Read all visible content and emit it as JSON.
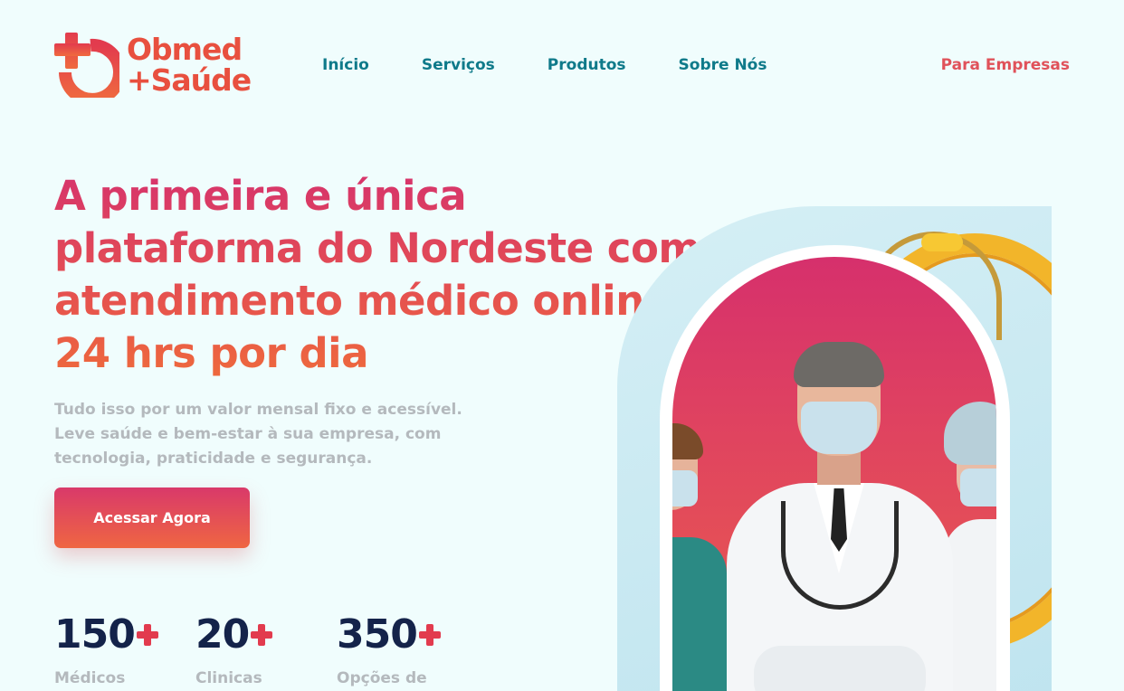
{
  "brand": {
    "name_line1": "Obmed",
    "name_line2": "+Saúde",
    "colors": {
      "primary": "#e8503f",
      "accent": "#d6336c",
      "nav": "#0f7a8a",
      "dark": "#14234a"
    }
  },
  "nav": {
    "items": [
      {
        "label": "Início"
      },
      {
        "label": "Serviços"
      },
      {
        "label": "Produtos"
      },
      {
        "label": "Sobre Nós"
      }
    ],
    "cta_label": "Para Empresas"
  },
  "hero": {
    "title_line1": "A primeira e única",
    "title_line2": "plataforma do Nordeste com",
    "title_line3": "atendimento médico online",
    "title_line4": "24 hrs por dia",
    "subtitle": "Tudo isso por um valor mensal fixo e acessível. Leve saúde e bem-estar à sua empresa, com tecnologia, praticidade e segurança.",
    "cta_label": "Acessar Agora"
  },
  "stats": [
    {
      "value": "150",
      "label": "Médicos"
    },
    {
      "value": "20",
      "label": "Clinicas"
    },
    {
      "value": "350",
      "label": "Opções de"
    }
  ],
  "image": {
    "icon": "doctors-photo"
  }
}
